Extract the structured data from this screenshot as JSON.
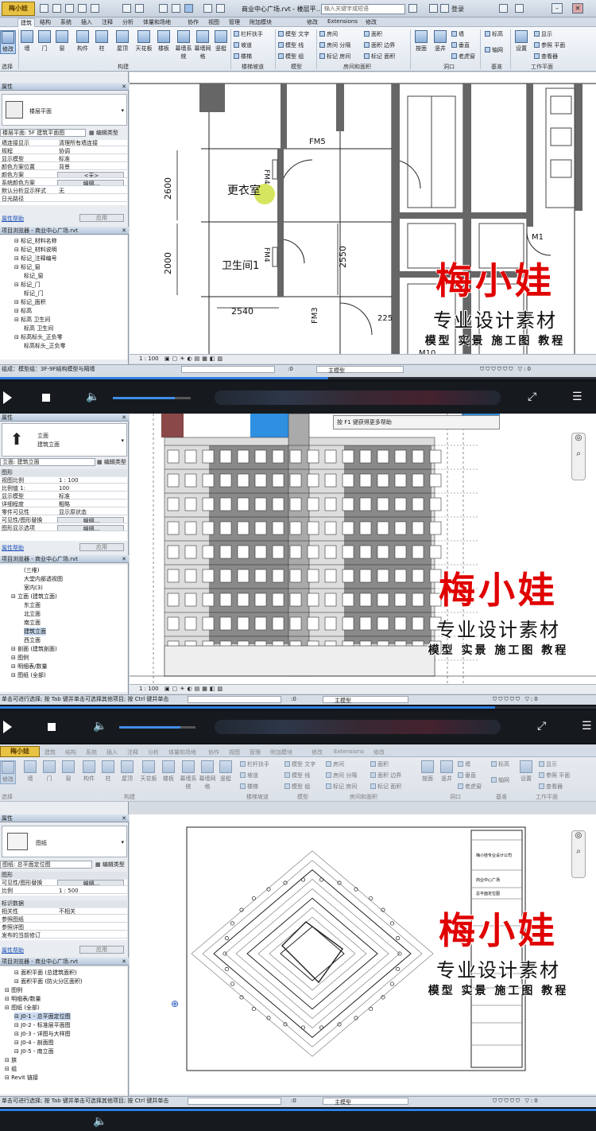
{
  "panel1": {
    "app_logo": "梅小娃",
    "title": "商业中心广场.rvt - 楼层平…",
    "search_placeholder": "输入关键字或短语",
    "login": "登录",
    "tabs": [
      "建筑",
      "结构",
      "系统",
      "插入",
      "注释",
      "分析",
      "体量和场地",
      "协作",
      "视图",
      "管理",
      "附加模块",
      "修改",
      "Extensions",
      "修改"
    ],
    "active_tab": "建筑",
    "ribbon": {
      "modify": "修改",
      "select": "选择",
      "build_buttons": [
        "墙",
        "门",
        "窗",
        "构件",
        "柱",
        "屋顶",
        "天花板",
        "楼板",
        "幕墙系统",
        "幕墙网格",
        "竖梃"
      ],
      "build_group": "构建",
      "circulation": [
        "栏杆扶手",
        "坡道",
        "楼梯"
      ],
      "circulation_group": "楼梯坡道",
      "model": [
        "模型 文字",
        "模型 线",
        "模型 组"
      ],
      "model_group": "模型",
      "room": [
        "房间",
        "房间 分隔",
        "标记 房间",
        "面积",
        "面积 边界",
        "标记 面积"
      ],
      "room_group": "房间和面积",
      "opening": [
        "按面",
        "竖井",
        "墙",
        "垂直",
        "老虎窗"
      ],
      "opening_group": "洞口",
      "datum": [
        "标高",
        "轴网"
      ],
      "datum_group": "基准",
      "workplane": [
        "设置",
        "显示",
        "参照 平面",
        "查看器"
      ],
      "workplane_group": "工作平面"
    },
    "properties": {
      "header": "属性",
      "type": "楼层平面",
      "selector": "楼层平面: 5F 建筑平面图",
      "edit_type": "编辑类型",
      "rows": [
        {
          "k": "墙连接显示",
          "v": "清理所有墙连接"
        },
        {
          "k": "规程",
          "v": "协调"
        },
        {
          "k": "显示模型",
          "v": "标准"
        },
        {
          "k": "颜色方案位置",
          "v": "背景"
        },
        {
          "k": "颜色方案",
          "v": "<无>"
        },
        {
          "k": "系统颜色方案",
          "v": "编辑..."
        },
        {
          "k": "默认分析显示样式",
          "v": "无"
        },
        {
          "k": "日光路径",
          "v": ""
        }
      ],
      "help": "属性帮助",
      "apply": "应用"
    },
    "browser": {
      "header": "项目浏览器 - 商业中心广场.rvt",
      "items": [
        "标记_材料名称",
        "标记_材料说明",
        "标记_注释编号",
        "标记_窗",
        "标记_窗",
        "标记_门",
        "标记_门",
        "标记_面积",
        "标高",
        "标高 卫生间",
        "标高 卫生间",
        "标高标头_正负零",
        "标高标头_正负零"
      ]
    },
    "drawing": {
      "room1": "更衣室",
      "room2": "卫生间1",
      "door1": "FM4",
      "door2": "FM4",
      "door3": "FM5",
      "door4": "FM3",
      "door5": "M1",
      "door6": "M10",
      "dim1": "2600",
      "dim2": "2000",
      "dim3": "2540",
      "dim4": "2550",
      "dim5": "225"
    },
    "view_scale": "1 : 100",
    "status_text": "组成：模型组：3F-9F结构模型与隔墙",
    "status_model": "主模型",
    "status_count": ":0"
  },
  "panel2": {
    "properties": {
      "header": "属性",
      "type_line1": "立面",
      "type_line2": "建筑立面",
      "selector": "立面: 建筑立面",
      "edit_type": "编辑类型",
      "section": "图形",
      "rows": [
        {
          "k": "视图比例",
          "v": "1 : 100"
        },
        {
          "k": "比例值 1:",
          "v": "100"
        },
        {
          "k": "显示模型",
          "v": "标准"
        },
        {
          "k": "详细程度",
          "v": "粗略"
        },
        {
          "k": "零件可见性",
          "v": "显示原状态"
        },
        {
          "k": "可见性/图形替换",
          "v": "编辑..."
        },
        {
          "k": "图形显示选项",
          "v": "编辑..."
        }
      ],
      "help": "属性帮助",
      "apply": "应用"
    },
    "browser": {
      "header": "项目浏览器 - 商业中心广场.rvt",
      "items": [
        "(三维)",
        "大堂内部透视图",
        "室内(3)",
        "立面 (建筑立面)",
        "东立面",
        "北立面",
        "南立面",
        "建筑立面",
        "西立面",
        "剖面 (建筑剖面)",
        "图例",
        "明细表/数量",
        "图纸 (全部)"
      ]
    },
    "tooltip": "按 F1 键获得更多帮助",
    "view_scale": "1 : 100",
    "status_text": "单击可进行选择; 按 Tab 键并单击可选择其他项目; 按 Ctrl 键并单击",
    "status_model": "主模型",
    "status_count": ":0"
  },
  "panel3": {
    "app_logo": "梅小娃",
    "tabs": [
      "建筑",
      "结构",
      "系统",
      "插入",
      "注释",
      "分析",
      "体量和场地",
      "协作",
      "视图",
      "管理",
      "附加模块",
      "修改",
      "Extensions",
      "修改"
    ],
    "properties": {
      "header": "属性",
      "type": "图纸",
      "selector": "图纸: 总平面定位图",
      "edit_type": "编辑类型",
      "section1": "图形",
      "rows1": [
        {
          "k": "可见性/图形替换",
          "v": "编辑..."
        },
        {
          "k": "比例",
          "v": "1 : 500"
        }
      ],
      "section2": "标识数据",
      "rows2": [
        {
          "k": "相关性",
          "v": "不相关"
        },
        {
          "k": "参照图纸",
          "v": ""
        },
        {
          "k": "参照详图",
          "v": ""
        },
        {
          "k": "发布的当前修订",
          "v": ""
        }
      ],
      "help": "属性帮助",
      "apply": "应用"
    },
    "browser": {
      "header": "项目浏览器 - 商业中心广场.rvt",
      "items": [
        "面积平面 (总建筑面积)",
        "面积平面 (防火分区面积)",
        "图例",
        "明细表/数量",
        "图纸 (全部)",
        "J0-1 - 总平面定位图",
        "J0-2 - 标准层平面图",
        "J0-3 - 详图与大样图",
        "J0-4 - 剖面图",
        "J0-5 - 南立面",
        "族",
        "组",
        "Revit 链接"
      ]
    },
    "sheet": {
      "block1": "梅小娃专业设计公司",
      "block2": "商业中心广场",
      "block3": "总平面定位图"
    },
    "status_text": "单击可进行选择; 按 Tab 键并单击可选择其他项目; 按 Ctrl 键并单击",
    "status_model": "主模型",
    "status_count": ":0"
  },
  "watermark": {
    "line1": "梅小娃",
    "line2": "专业设计素材",
    "line3": "模型 实景 施工图 教程"
  },
  "player": {
    "volume": 0.8,
    "progress1": 0.55,
    "progress2": 0.83
  },
  "colors": {
    "accent": "#2f7fe0",
    "watermark_red": "#e00000",
    "wall_dark": "#666666",
    "facade_gray": "#8a8a8a",
    "facade_blue": "#2f8fe0"
  }
}
